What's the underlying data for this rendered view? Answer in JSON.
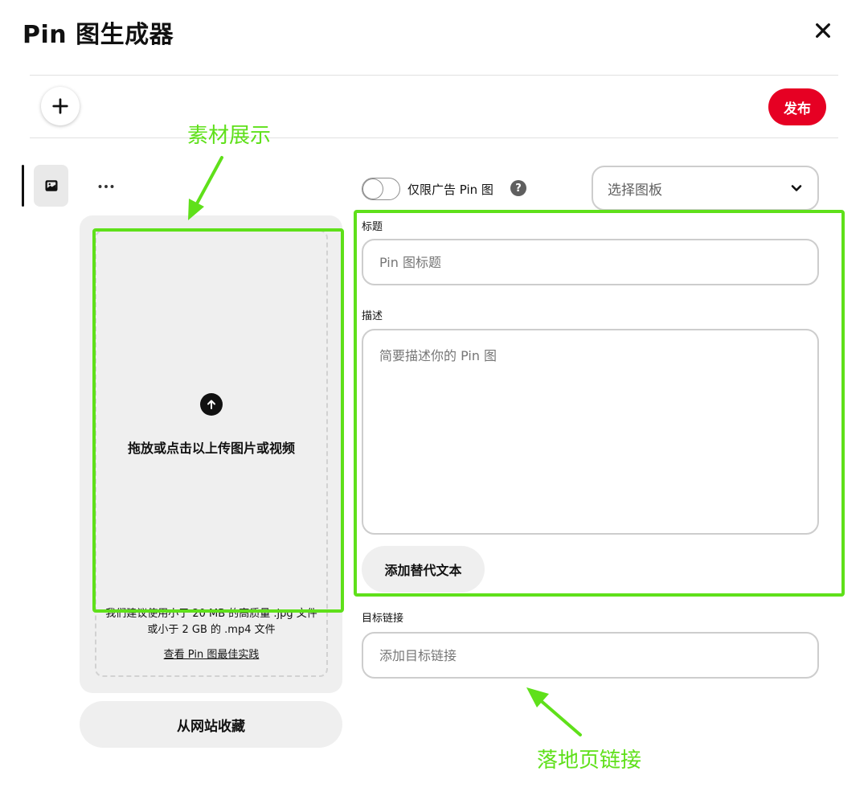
{
  "header": {
    "title": "Pin 图生成器",
    "close_icon": "close-icon"
  },
  "toolbar": {
    "add_icon": "plus-icon",
    "publish_label": "发布"
  },
  "sidebar": {
    "thumbnail_icon": "image-icon",
    "more_icon": "more-horizontal-icon"
  },
  "upload": {
    "icon": "upload-arrow-icon",
    "prompt": "拖放或点击以上传图片或视频",
    "tip": "我们建议使用小于 20 MB 的高质量 .jpg 文件或小于 2 GB 的 .mp4 文件",
    "best_practice_link": "查看 Pin 图最佳实践",
    "save_from_site_label": "从网站收藏"
  },
  "options": {
    "ads_only_label": "仅限广告 Pin 图",
    "help_glyph": "?",
    "board_select_placeholder": "选择图板"
  },
  "form": {
    "title_label": "标题",
    "title_placeholder": "Pin 图标题",
    "description_label": "描述",
    "description_placeholder": "简要描述你的 Pin 图",
    "alt_text_label": "添加替代文本",
    "link_label": "目标链接",
    "link_placeholder": "添加目标链接"
  },
  "annotations": {
    "material_label": "素材展示",
    "landing_label": "落地页链接",
    "highlight_color": "#5fe01a"
  },
  "colors": {
    "brand_red": "#e60023"
  }
}
